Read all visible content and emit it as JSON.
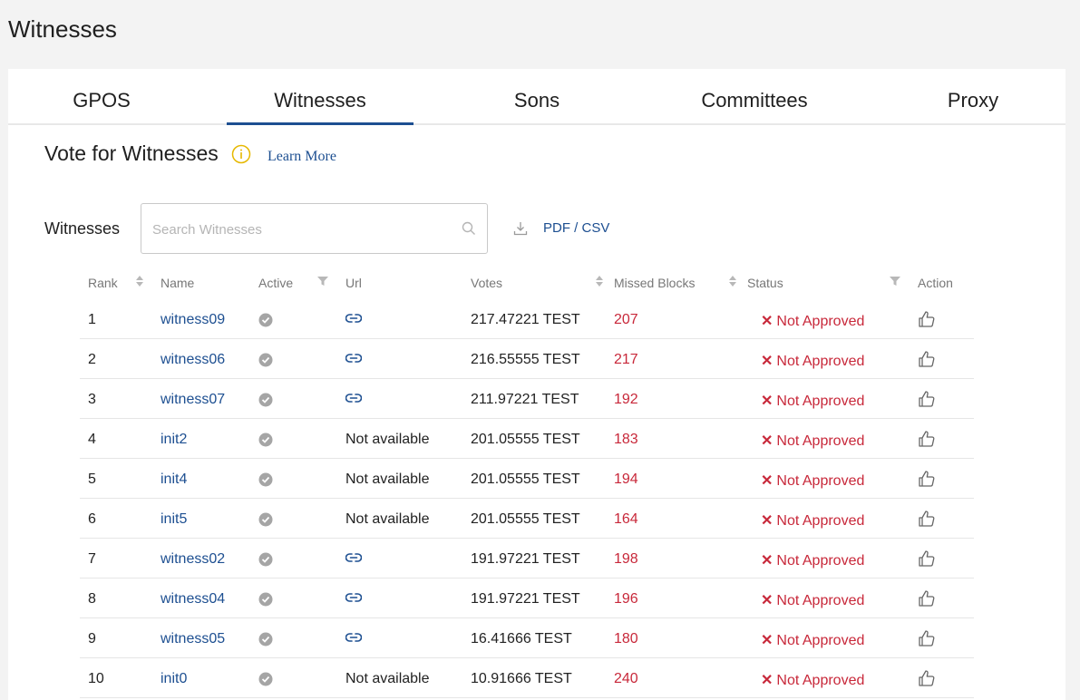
{
  "page": {
    "title": "Witnesses"
  },
  "tabs": [
    {
      "label": "GPOS"
    },
    {
      "label": "Witnesses"
    },
    {
      "label": "Sons"
    },
    {
      "label": "Committees"
    },
    {
      "label": "Proxy"
    }
  ],
  "active_tab": "Witnesses",
  "section": {
    "title": "Vote for Witnesses",
    "learn_more": "Learn More"
  },
  "search": {
    "label": "Witnesses",
    "placeholder": "Search Witnesses",
    "value": ""
  },
  "export": {
    "label": "PDF / CSV"
  },
  "table": {
    "headers": {
      "rank": "Rank",
      "name": "Name",
      "active": "Active",
      "url": "Url",
      "votes": "Votes",
      "missed_blocks": "Missed Blocks",
      "status": "Status",
      "action": "Action"
    },
    "rows": [
      {
        "rank": "1",
        "name": "witness09",
        "url": "link-icon",
        "votes": "217.47221 TEST",
        "missed": "207",
        "status": "Not Approved"
      },
      {
        "rank": "2",
        "name": "witness06",
        "url": "link-icon",
        "votes": "216.55555 TEST",
        "missed": "217",
        "status": "Not Approved"
      },
      {
        "rank": "3",
        "name": "witness07",
        "url": "link-icon",
        "votes": "211.97221 TEST",
        "missed": "192",
        "status": "Not Approved"
      },
      {
        "rank": "4",
        "name": "init2",
        "url": "Not available",
        "votes": "201.05555 TEST",
        "missed": "183",
        "status": "Not Approved"
      },
      {
        "rank": "5",
        "name": "init4",
        "url": "Not available",
        "votes": "201.05555 TEST",
        "missed": "194",
        "status": "Not Approved"
      },
      {
        "rank": "6",
        "name": "init5",
        "url": "Not available",
        "votes": "201.05555 TEST",
        "missed": "164",
        "status": "Not Approved"
      },
      {
        "rank": "7",
        "name": "witness02",
        "url": "link-icon",
        "votes": "191.97221 TEST",
        "missed": "198",
        "status": "Not Approved"
      },
      {
        "rank": "8",
        "name": "witness04",
        "url": "link-icon",
        "votes": "191.97221 TEST",
        "missed": "196",
        "status": "Not Approved"
      },
      {
        "rank": "9",
        "name": "witness05",
        "url": "link-icon",
        "votes": "16.41666 TEST",
        "missed": "180",
        "status": "Not Approved"
      },
      {
        "rank": "10",
        "name": "init0",
        "url": "Not available",
        "votes": "10.91666 TEST",
        "missed": "240",
        "status": "Not Approved"
      }
    ]
  },
  "colors": {
    "accent": "#1d4f91",
    "danger": "#c8283a",
    "info": "#e6b800",
    "muted": "#9a9a9a"
  }
}
